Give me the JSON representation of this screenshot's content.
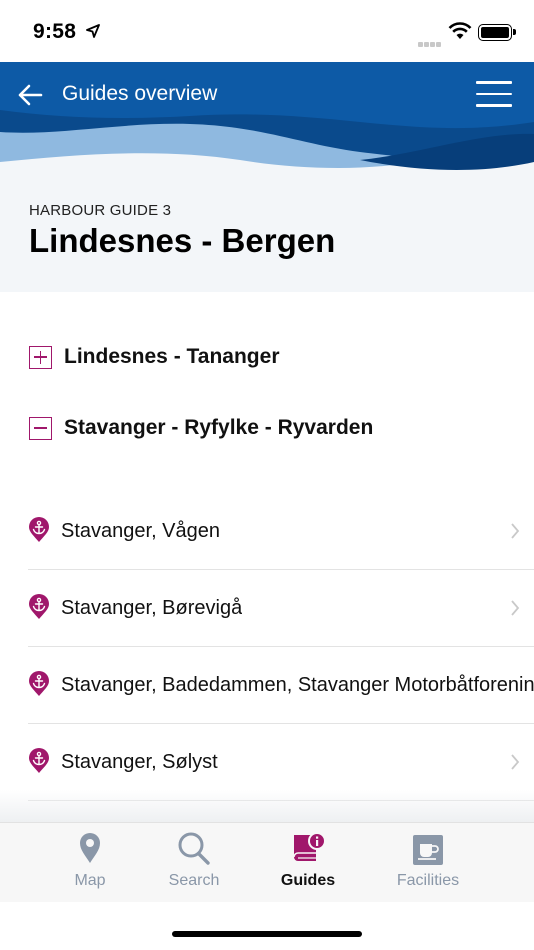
{
  "status_bar": {
    "time": "9:58"
  },
  "header": {
    "back_label": "Guides overview"
  },
  "guide": {
    "kicker": "HARBOUR GUIDE 3",
    "title": "Lindesnes - Bergen"
  },
  "sections": [
    {
      "label": "Lindesnes - Tananger",
      "state": "collapsed"
    },
    {
      "label": "Stavanger - Ryfylke - Ryvarden",
      "state": "expanded"
    }
  ],
  "harbours": [
    {
      "name": "Stavanger, Vågen"
    },
    {
      "name": "Stavanger, Børevigå"
    },
    {
      "name": "Stavanger, Badedammen, Stavanger Motorbåtforening"
    },
    {
      "name": "Stavanger, Sølyst"
    }
  ],
  "tabs": [
    {
      "label": "Map",
      "icon": "map-pin-icon"
    },
    {
      "label": "Search",
      "icon": "search-icon"
    },
    {
      "label": "Guides",
      "icon": "book-info-icon"
    },
    {
      "label": "Facilities",
      "icon": "cup-icon"
    }
  ],
  "active_tab": "Guides",
  "colors": {
    "accent": "#a0176b",
    "header_dark": "#0b4f93",
    "header_light": "#8fb9e0",
    "tab_inactive": "#8a97a8"
  }
}
